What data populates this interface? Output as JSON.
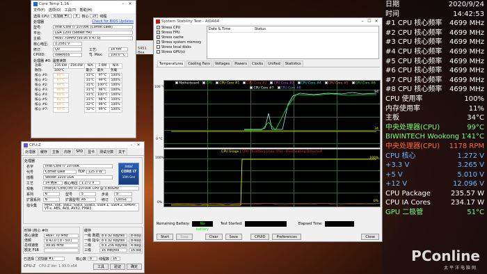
{
  "desktop": {
    "logo": "PConline",
    "logo_sub": "太平洋电脑网",
    "partial_text": "5451 Bea"
  },
  "coretemp": {
    "title": "Core Temp 1.16",
    "menu": [
      "文件(F)",
      "选项(O)",
      "工具(T)",
      "帮助(H)"
    ],
    "select_cpu_label": "选择 CPU:",
    "cpu_index": "处理器 #0",
    "cores_count": "8",
    "cores_label": "核心",
    "threads_count": "16",
    "threads_label": "线程",
    "check_link": "Check for BIOS Updates",
    "info_header": "处理器",
    "rows": [
      {
        "label": "型号:",
        "value": "Intel Core i7 10700K (Comet Lake)"
      },
      {
        "label": "平台:",
        "value": "LGA 1200 (Socket H4)"
      },
      {
        "label": "主频:",
        "value": "4697.70MHz (99.95 x 47.0)"
      }
    ],
    "vid_label": "核心电压:",
    "vid": "1.2581 v",
    "mod_label": "修订:",
    "mod": "Q0",
    "tech_label": "工艺:",
    "tech": "14 nm",
    "cpuid_label": "CPUID:",
    "cpuid": "0xA0655",
    "tjmax_label": "TJ. Max:",
    "tjmax": "100.0 °C",
    "readings_header": "处理器 #0: 温度读数",
    "power_row": {
      "label": "功率:",
      "v1": "235.6W",
      "v2": "234.0W",
      "v3": "N/A",
      "v4": "1.6W",
      "v5": "N/A"
    },
    "head_row": {
      "label": "散热:",
      "v1": "100°C",
      "c_min": "最小",
      "c_max": "最大",
      "c_load": "负载"
    },
    "cores": [
      {
        "label": "核心 #0:",
        "temp": "90°C",
        "min": "31°C",
        "max": "97°C",
        "load": "100%"
      },
      {
        "label": "核心 #1:",
        "temp": "97°C",
        "min": "31°C",
        "max": "99°C",
        "load": "100%"
      },
      {
        "label": "核心 #2:",
        "temp": "94°C",
        "min": "31°C",
        "max": "100°C",
        "load": "100%"
      },
      {
        "label": "核心 #3:",
        "temp": "96°C",
        "min": "31°C",
        "max": "96°C",
        "load": "100%"
      },
      {
        "label": "核心 #4:",
        "temp": "94°C",
        "min": "31°C",
        "max": "100°C",
        "load": "100%"
      },
      {
        "label": "核心 #5:",
        "temp": "93°C",
        "min": "31°C",
        "max": "98°C",
        "load": "100%"
      },
      {
        "label": "核心 #6:",
        "temp": "89°C",
        "min": "32°C",
        "max": "99°C",
        "load": "100%"
      },
      {
        "label": "核心 #7:",
        "temp": "94°C",
        "min": "32°C",
        "max": "99°C",
        "load": "100%"
      }
    ]
  },
  "cpuz": {
    "title": "CPU-Z",
    "tabs": [
      "处理器",
      "缓存",
      "主板",
      "内存",
      "SPD",
      "显卡",
      "测试分数",
      "关于"
    ],
    "proc_header": "处理器",
    "name_label": "名字",
    "name": "Intel Core i7 10700K",
    "code_label": "代号",
    "code": "Comet Lake",
    "tdp_label": "TDP",
    "tdp": "125.0 W",
    "pkg_label": "插槽",
    "pkg": "Socket 1200 LGA",
    "tech_label": "工艺",
    "tech": "14 纳米",
    "vcore_label": "核心电压",
    "vcore": "1.272 V",
    "spec_label": "规格",
    "spec": "Intel(R) Core(TM) i7-10700K CPU @ 3.80GHz",
    "family_label": "系列",
    "family": "6",
    "model_label": "型号",
    "model": "5",
    "step_label": "步进",
    "step": "5",
    "extfam_label": "扩展系列",
    "extfam": "6",
    "extmod_label": "扩展型号",
    "extmod": "A5",
    "rev_label": "修订",
    "rev": "Q0/G1",
    "instr_label": "指令集",
    "instr": "MMX, SSE, SSE2, SSE3, SSSE3, SSE4.1, SSE4.2, EM64T, VT-x, AES, AVX, AVX2, FMA3",
    "clocks_header": "时钟 (核心 #0)",
    "cache_header": "缓存",
    "core_speed_label": "核心速度",
    "core_speed": "4697.70 MHz",
    "mult_label": "倍频",
    "mult": "x 47.0 ( 8 - 50 )",
    "bus_label": "总线速度",
    "bus": "99.95 MHz",
    "fsb_label": "额定 FSB",
    "fsb": "",
    "l1d_label": "一级 数据",
    "l1d": "8 x 32 KBytes",
    "l1d_w": "8-way",
    "l1i_label": "一级 指令",
    "l1i": "8 x 32 KBytes",
    "l1i_w": "8-way",
    "l2_label": "二级",
    "l2": "8 x 256 KBytes",
    "l2_w": "4-way",
    "l3_label": "三级",
    "l3": "16 MBytes",
    "l3_w": "16-way",
    "sel_label": "已选择",
    "sel": "处理器 #1",
    "cores_label": "核心数",
    "cores": "8",
    "threads_label": "线程数",
    "threads": "16",
    "ver": "CPU-Z  Ver. 1.93.0.x64",
    "tools": "工具",
    "validate": "验证",
    "ok": "确定",
    "badge_line1": "intel",
    "badge_line2": "CORE i7",
    "badge_line3": "10th Gen"
  },
  "aida": {
    "title": "System Stability Test - AIDA64",
    "stress": [
      {
        "label": "Stress CPU",
        "checked": true
      },
      {
        "label": "Stress FPU",
        "checked": true
      },
      {
        "label": "Stress cache",
        "checked": true
      },
      {
        "label": "Stress system memory",
        "checked": true
      },
      {
        "label": "Stress local disks",
        "checked": false
      },
      {
        "label": "Stress GPU(s)",
        "checked": false
      }
    ],
    "log_col1": "Date & Time",
    "log_col2": "Status",
    "tabs": [
      "Temperatures",
      "Cooling Fans",
      "Voltages",
      "Powers",
      "Clocks",
      "Unified",
      "Statistics"
    ],
    "legend": [
      {
        "label": "Motherboard",
        "color": "#ffffff"
      },
      {
        "label": "CPU",
        "color": "#00ff00"
      },
      {
        "label": "CPU Core #1",
        "color": "#ffff00"
      },
      {
        "label": "CPU Core #2",
        "color": "#ff3030"
      },
      {
        "label": "CPU Core #3",
        "color": "#ff40ff"
      },
      {
        "label": "CPU Core #4",
        "color": "#00ffff"
      },
      {
        "label": "CPU Core #5",
        "color": "#ff8040"
      },
      {
        "label": "CPU Core #6",
        "color": "#40ff40"
      },
      {
        "label": "CPU Core #7",
        "color": "#ffffff"
      },
      {
        "label": "CPU Core #8",
        "color": "#8080ff"
      }
    ],
    "temp_ymax": "100 °C",
    "temp_ymin": "0 °C",
    "temp_r1": "94",
    "temp_r2": "34",
    "usage_title1": "CPU Usage",
    "usage_sep": " | ",
    "usage_title2": "CPU Throttling (max: 0%) - Overheating Detected!",
    "usage_ymax": "100%",
    "usage_ymin": "0%",
    "usage_r1": "100%",
    "usage_r2": "0%",
    "battery_label": "Remaining Battery:",
    "battery": "No battery",
    "started_label": "Test Started:",
    "started": "",
    "elapsed_label": "Elapsed Time:",
    "elapsed": "",
    "buttons": [
      "Start",
      "Stop",
      "Clear",
      "Save",
      "CPUID",
      "Preferences",
      "Close"
    ]
  },
  "panel": {
    "rows": [
      {
        "label": "日期",
        "value": "2020/9/24",
        "color": "#ffffff"
      },
      {
        "label": "时间",
        "value": "14:42:53",
        "color": "#ffffff"
      },
      {
        "label": "#1 CPU 核心频率",
        "value": "4699 MHz",
        "color": "#ffffff"
      },
      {
        "label": "#2 CPU 核心频率",
        "value": "4699 MHz",
        "color": "#ffffff"
      },
      {
        "label": "#3 CPU 核心频率",
        "value": "4699 MHz",
        "color": "#ffffff"
      },
      {
        "label": "#4 CPU 核心频率",
        "value": "4699 MHz",
        "color": "#ffffff"
      },
      {
        "label": "#5 CPU 核心频率",
        "value": "4699 MHz",
        "color": "#ffffff"
      },
      {
        "label": "#6 CPU 核心频率",
        "value": "4699 MHz",
        "color": "#ffffff"
      },
      {
        "label": "#7 CPU 核心频率",
        "value": "4699 MHz",
        "color": "#ffffff"
      },
      {
        "label": "#8 CPU 核心频率",
        "value": "4699 MHz",
        "color": "#ffffff"
      },
      {
        "label": "CPU 使用率",
        "value": "100%",
        "color": "#ffffff"
      },
      {
        "label": "内存使用率",
        "value": "11%",
        "color": "#ffffff"
      },
      {
        "label": "主板",
        "value": "34°C",
        "color": "#ffffff"
      },
      {
        "label": "中央处理器(CPU)",
        "value": "99°C",
        "color": "#7cff7c"
      },
      {
        "label": "BIWINTECH Wookong 1TB",
        "value": "41°C",
        "color": "#7cff7c"
      },
      {
        "label": "中央处理器(CPU)",
        "value": "1178 RPM",
        "color": "#ff6a3a"
      },
      {
        "label": "CPU 核心",
        "value": "1.272 V",
        "color": "#6ab8ff"
      },
      {
        "label": "+3.3 V",
        "value": "3.265 V",
        "color": "#6ab8ff"
      },
      {
        "label": "+5 V",
        "value": "5.010 V",
        "color": "#6ab8ff"
      },
      {
        "label": "+12 V",
        "value": "12.096 V",
        "color": "#6ab8ff"
      },
      {
        "label": "CPU Package",
        "value": "235.57 W",
        "color": "#ffffff"
      },
      {
        "label": "CPU IA Cores",
        "value": "234.17 W",
        "color": "#ffffff"
      },
      {
        "label": "GPU 二极管",
        "value": "51°C",
        "color": "#7cff7c"
      }
    ]
  }
}
